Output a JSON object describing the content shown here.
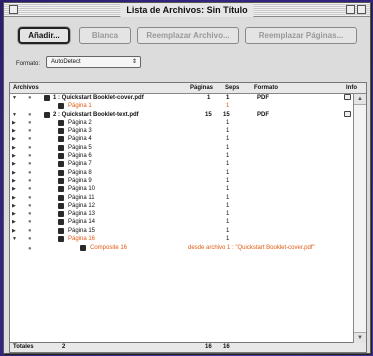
{
  "window": {
    "title": "Lista de Archivos: Sin Título"
  },
  "toolbar": {
    "add_label": "Añadir...",
    "blank_label": "Blanca",
    "replace_file_label": "Reemplazar Archivo...",
    "replace_pages_label": "Reemplazar Páginas...",
    "format_label": "Formato:",
    "format_value": "AutoDetect"
  },
  "table": {
    "headers": {
      "archivos": "Archivos",
      "paginas": "Páginas",
      "seps": "Seps",
      "formato": "Formato",
      "info": "Info"
    },
    "rows": [
      {
        "label": "1 : Quickstart Booklet-cover.pdf",
        "paginas": "1",
        "seps": "1",
        "formato": "PDF"
      },
      {
        "label": "Página 1",
        "seps": "1"
      },
      {
        "label": "2 : Quickstart Booklet-text.pdf",
        "paginas": "15",
        "seps": "15",
        "formato": "PDF"
      },
      {
        "label": "Página 2",
        "seps": "1"
      },
      {
        "label": "Página 3",
        "seps": "1"
      },
      {
        "label": "Página 4",
        "seps": "1"
      },
      {
        "label": "Página 5",
        "seps": "1"
      },
      {
        "label": "Página 6",
        "seps": "1"
      },
      {
        "label": "Página 7",
        "seps": "1"
      },
      {
        "label": "Página 8",
        "seps": "1"
      },
      {
        "label": "Página 9",
        "seps": "1"
      },
      {
        "label": "Página 10",
        "seps": "1"
      },
      {
        "label": "Página 11",
        "seps": "1"
      },
      {
        "label": "Página 12",
        "seps": "1"
      },
      {
        "label": "Página 13",
        "seps": "1"
      },
      {
        "label": "Página 14",
        "seps": "1"
      },
      {
        "label": "Página 15",
        "seps": "1"
      },
      {
        "label": "Página 16",
        "seps": "1"
      },
      {
        "label": "Composite 16",
        "source": "desde archivo 1 : \"Quickstart Booklet-cover.pdf\""
      }
    ]
  },
  "footer": {
    "label": "Totales",
    "files": "2",
    "paginas": "16",
    "seps": "16"
  },
  "colors": {
    "highlight": "#e05a10",
    "background": "#3b2a8f"
  }
}
